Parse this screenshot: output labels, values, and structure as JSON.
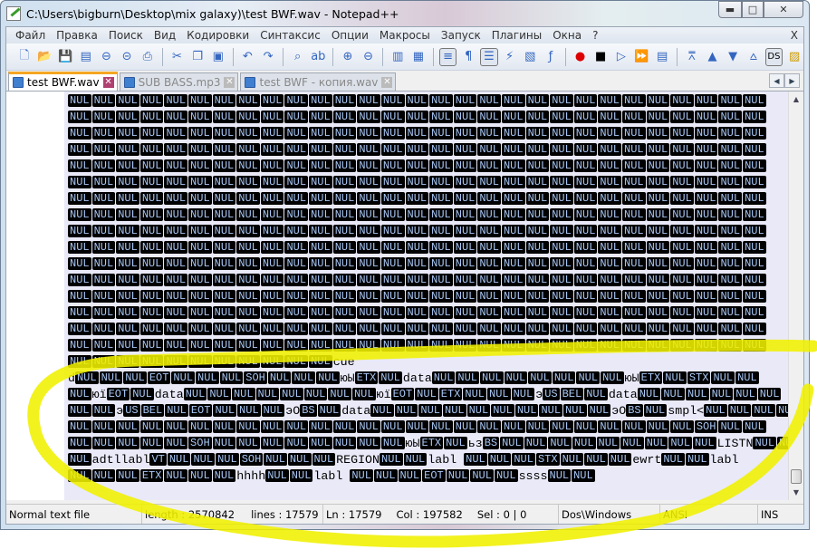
{
  "window": {
    "title": "C:\\Users\\bigburn\\Desktop\\mix galaxy)\\test BWF.wav - Notepad++",
    "minimize": "▬",
    "maximize": "□",
    "close": "✕"
  },
  "menu": [
    "Файл",
    "Правка",
    "Поиск",
    "Вид",
    "Кодировки",
    "Синтаксис",
    "Опции",
    "Макросы",
    "Запуск",
    "Плагины",
    "Окна",
    "?"
  ],
  "menu_close": "X",
  "toolbar": [
    {
      "name": "new-file-icon",
      "g": "🗋"
    },
    {
      "name": "open-file-icon",
      "g": "📂"
    },
    {
      "name": "save-icon",
      "g": "💾"
    },
    {
      "name": "save-all-icon",
      "g": "▤"
    },
    {
      "name": "close-icon",
      "g": "⊖"
    },
    {
      "name": "close-all-icon",
      "g": "⊝"
    },
    {
      "name": "print-icon",
      "g": "⎙"
    },
    "sep",
    {
      "name": "cut-icon",
      "g": "✂"
    },
    {
      "name": "copy-icon",
      "g": "❐"
    },
    {
      "name": "paste-icon",
      "g": "▣"
    },
    "sep",
    {
      "name": "undo-icon",
      "g": "↶"
    },
    {
      "name": "redo-icon",
      "g": "↷"
    },
    "sep",
    {
      "name": "find-icon",
      "g": "⌕"
    },
    {
      "name": "replace-icon",
      "g": "ab"
    },
    "sep",
    {
      "name": "zoom-in-icon",
      "g": "⊕"
    },
    {
      "name": "zoom-out-icon",
      "g": "⊖"
    },
    "sep",
    {
      "name": "sync-vertical-icon",
      "g": "▥"
    },
    {
      "name": "sync-horizontal-icon",
      "g": "▦"
    },
    "sep",
    {
      "name": "word-wrap-icon",
      "g": "≡",
      "on": true
    },
    {
      "name": "show-all-chars-icon",
      "g": "¶"
    },
    {
      "name": "indent-guide-icon",
      "g": "☰",
      "on": true
    },
    {
      "name": "user-language-icon",
      "g": "⚡"
    },
    {
      "name": "doc-map-icon",
      "g": "▧"
    },
    {
      "name": "function-list-icon",
      "g": "ƒ"
    },
    "sep",
    {
      "name": "record-macro-icon",
      "g": "●",
      "c": "#d00"
    },
    {
      "name": "stop-record-icon",
      "g": "■",
      "c": "#000"
    },
    {
      "name": "play-macro-icon",
      "g": "▷"
    },
    {
      "name": "play-multiple-icon",
      "g": "⏩"
    },
    {
      "name": "save-macro-icon",
      "g": "▤"
    },
    "sep",
    {
      "name": "first-bookmark-icon",
      "g": "⩞"
    },
    {
      "name": "prev-bookmark-icon",
      "g": "▲"
    },
    {
      "name": "next-bookmark-icon",
      "g": "▼"
    },
    {
      "name": "last-bookmark-icon",
      "g": "⩟"
    },
    {
      "name": "spellcheck-icon",
      "g": "DS",
      "on": true,
      "c": "#000"
    },
    {
      "name": "plugin-icon",
      "g": "▨",
      "c": "#c90"
    }
  ],
  "tabs": [
    {
      "label": "test BWF.wav",
      "active": true
    },
    {
      "label": "SUB BASS.mp3"
    },
    {
      "label": "test BWF - копия.wav"
    }
  ],
  "editor": {
    "full_nul_rows": 16,
    "nul_per_row": 29,
    "lines": [
      "{NUL}{NUL}{NUL}{NUL}{NUL}{NUL}{NUL}{NUL}{NUL}{NUL}{NUL}cue",
      "d{NUL}{NUL}{NUL}{EOT}{NUL}{NUL}{NUL}{SOH}{NUL}{NUL}{NUL}юЫ{ETX}{NUL}data{NUL}{NUL}{NUL}{NUL}{NUL}{NUL}{NUL}{NUL}юЫ{ETX}{NUL}{STX}{NUL}{NUL}",
      "{NUL}юї{EOT}{NUL}data{NUL}{NUL}{NUL}{NUL}{NUL}{NUL}{NUL}{NUL}юї{EOT}{NUL}{ETX}{NUL}{NUL}{NUL}э{US}{BEL}{NUL}data{NUL}{NUL}{NUL}{NUL}{NUL}{NUL}",
      "{NUL}{NUL}э{US}{BEL}{NUL}{EOT}{NUL}{NUL}{NUL}эO{BS}{NUL}data{NUL}{NUL}{NUL}{NUL}{NUL}{NUL}{NUL}{NUL}{NUL}{NUL}эO{BS}{NUL}smpl<{NUL}{NUL}{NUL}{NUL}{NUL}",
      "{NUL}{NUL}{NUL}{NUL}{NUL}{NUL}{NUL}{NUL}{NUL}{NUL}{NUL}{NUL}{NUL}{NUL}{NUL}{NUL}{NUL}{NUL}{NUL}{NUL}{NUL}{NUL}{NUL}{NUL}{NUL}{NUL}{SOH}{NUL}{NUL}",
      "{NUL}{NUL}{NUL}{NUL}{NUL}{SOH}{NUL}{NUL}{NUL}{NUL}{NUL}{NUL}{NUL}{NUL}юЫ{ETX}{NUL}ьз{BS}{NUL}{NUL}{NUL}{NUL}{NUL}{NUL}{NUL}{NUL}{NUL}LISTN{NUL}{NUL}",
      "{NUL}adtllabl{VT}{NUL}{NUL}{NUL}{SOH}{NUL}{NUL}{NUL}REGION{NUL}{NUL}labl  {NUL}{NUL}{NUL}{STX}{NUL}{NUL}{NUL}ewrt{NUL}{NUL}labl",
      "{NUL}{NUL}{NUL}{ETX}{NUL}{NUL}{NUL}hhhh{NUL}{NUL}labl  {NUL}{NUL}{NUL}{EOT}{NUL}{NUL}{NUL}ssss{NUL}{NUL}"
    ]
  },
  "status": {
    "type": "Normal text file",
    "length": "length : 2570842",
    "lines": "lines : 17579",
    "ln": "Ln : 17579",
    "col": "Col : 197582",
    "sel": "Sel : 0 | 0",
    "eol": "Dos\\Windows",
    "encoding": "ANSI",
    "mode": "INS"
  },
  "colors": {
    "highlighter": "#f0f000",
    "tab_accent": "#f5a623",
    "editor_bg": "#e9e9f8",
    "control_char_bg": "#000000"
  }
}
